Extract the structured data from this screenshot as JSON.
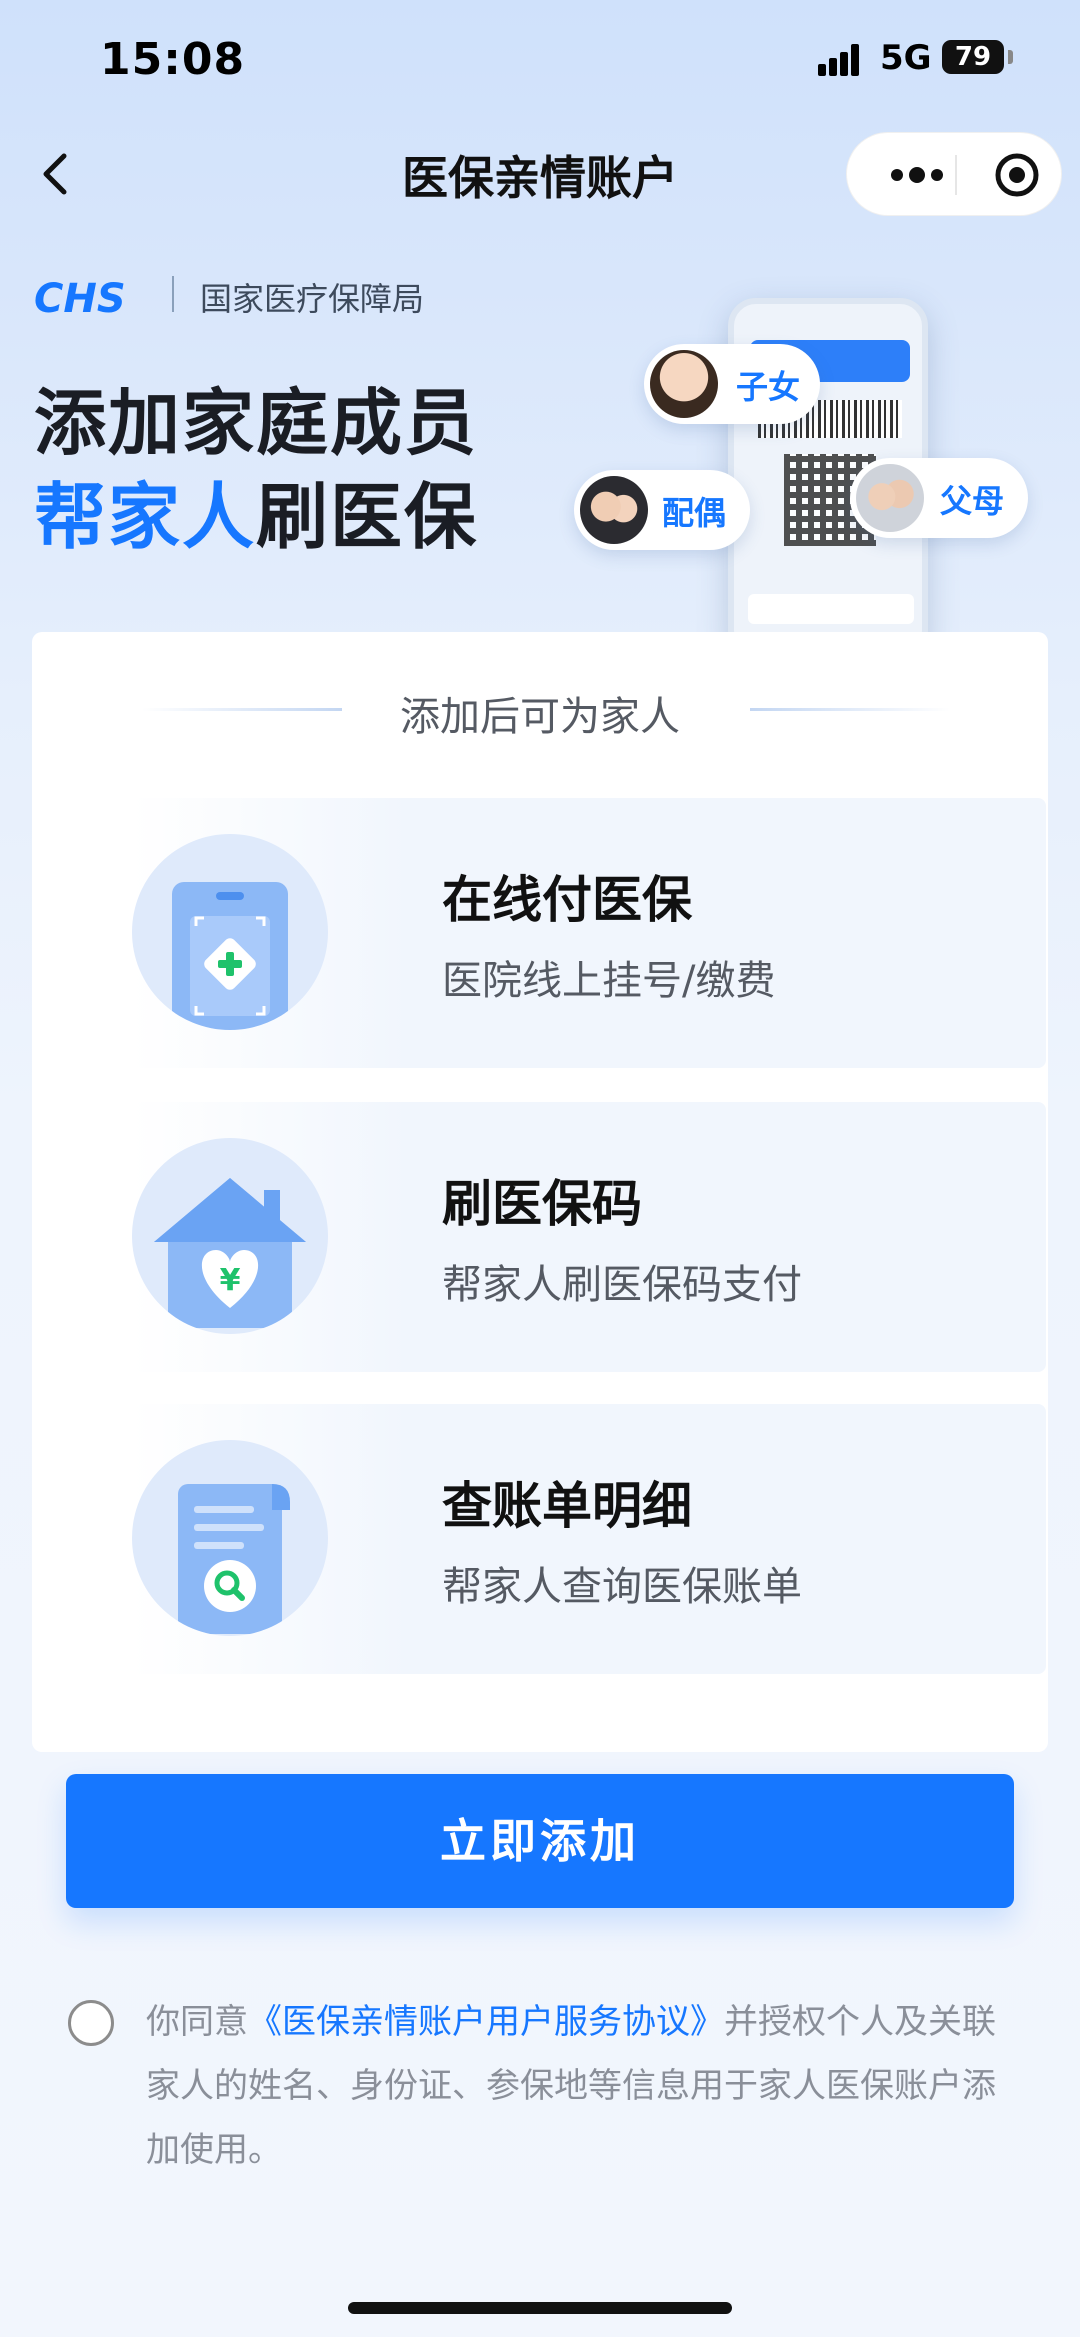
{
  "status_bar": {
    "time": "15:08",
    "network": "5G",
    "battery": "79"
  },
  "nav": {
    "title": "医保亲情账户",
    "back_icon": "chevron-left-icon",
    "more_icon": "more-dots-icon",
    "close_icon": "target-icon"
  },
  "banner": {
    "logo_text": "CHS",
    "bureau": "国家医疗保障局",
    "headline_line1": "添加家庭成员",
    "headline_line2_highlight": "帮家人",
    "headline_line2_rest": "刷医保",
    "bubbles": {
      "child": "子女",
      "spouse": "配偶",
      "parents": "父母"
    }
  },
  "card": {
    "header": "添加后可为家人",
    "features": [
      {
        "title": "在线付医保",
        "desc": "医院线上挂号/缴费",
        "icon": "medical-card-icon"
      },
      {
        "title": "刷医保码",
        "desc": "帮家人刷医保码支付",
        "icon": "house-heart-yuan-icon"
      },
      {
        "title": "查账单明细",
        "desc": "帮家人查询医保账单",
        "icon": "bill-search-icon"
      }
    ]
  },
  "action": {
    "add_now": "立即添加"
  },
  "agreement": {
    "prefix": "你同意",
    "link": "《医保亲情账户用户服务协议》",
    "suffix": "并授权个人及关联家人的姓名、身份证、参保地等信息用于家人医保账户添加使用。"
  },
  "colors": {
    "primary": "#1677ff",
    "title": "#111111",
    "muted": "#8a8f99"
  }
}
